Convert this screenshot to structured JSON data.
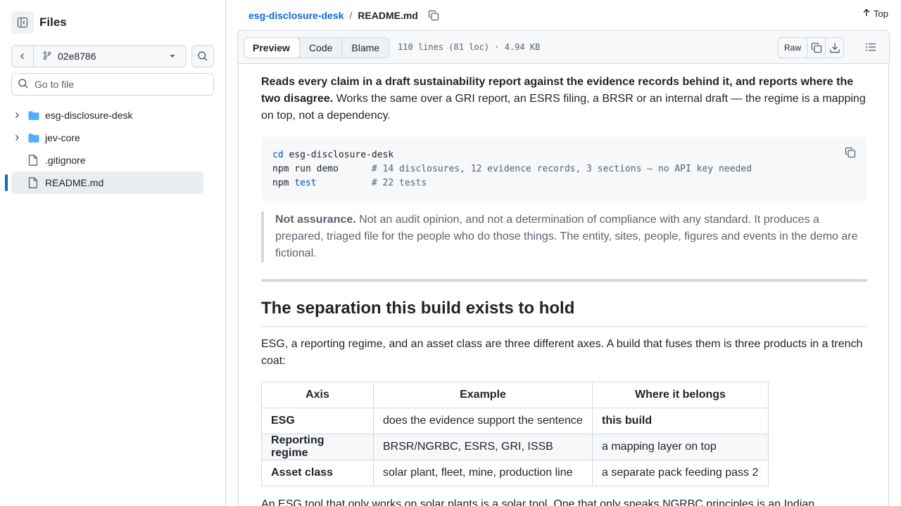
{
  "sidebar": {
    "title": "Files",
    "branch": "02e8786",
    "goto_placeholder": "Go to file",
    "tree": [
      {
        "label": "esg-disclosure-desk",
        "type": "folder"
      },
      {
        "label": "jev-core",
        "type": "folder"
      },
      {
        "label": ".gitignore",
        "type": "file"
      },
      {
        "label": "README.md",
        "type": "file",
        "active": true
      }
    ]
  },
  "breadcrumb": {
    "repo": "esg-disclosure-desk",
    "separator": "/",
    "file": "README.md"
  },
  "top_label": "Top",
  "file_header": {
    "tabs": [
      "Preview",
      "Code",
      "Blame"
    ],
    "active_tab": "Preview",
    "meta": "110 lines (81 loc) · 4.94 KB",
    "raw_label": "Raw"
  },
  "readme": {
    "lead_bold": "Reads every claim in a draft sustainability report against the evidence records behind it, and reports where the two disagree.",
    "lead_rest": " Works the same over a GRI report, an ESRS filing, a BRSR or an internal draft — the regime is a mapping on top, not a dependency.",
    "code": {
      "line1_cmd": "cd",
      "line1_rest": " esg-disclosure-desk",
      "line2_cmd": "npm run demo      ",
      "line2_comment": "# 14 disclosures, 12 evidence records, 3 sections — no API key needed",
      "line3_cmd": "npm ",
      "line3_kw": "test",
      "line3_pad": "          ",
      "line3_comment": "# 22 tests"
    },
    "quote_bold": "Not assurance.",
    "quote_rest": " Not an audit opinion, and not a determination of compliance with any standard. It produces a prepared, triaged file for the people who do those things. The entity, sites, people, figures and events in the demo are fictional.",
    "heading": "The separation this build exists to hold",
    "paragraph": "ESG, a reporting regime, and an asset class are three different axes. A build that fuses them is three products in a trench coat:",
    "table": {
      "headers": [
        "Axis",
        "Example",
        "Where it belongs"
      ],
      "rows": [
        [
          "ESG",
          "does the evidence support the sentence",
          "this build"
        ],
        [
          "Reporting regime",
          "BRSR/NGRBC, ESRS, GRI, ISSB",
          "a mapping layer on top"
        ],
        [
          "Asset class",
          "solar plant, fleet, mine, production line",
          "a separate pack feeding pass 2"
        ]
      ]
    },
    "tail": "An ESG tool that only works on solar plants is a solar tool. One that only speaks NGRBC principles is an Indian"
  },
  "icons": [
    "sidebar-collapse-icon",
    "chevron-left-icon",
    "git-branch-icon",
    "triangle-down-icon",
    "search-icon",
    "chevron-right-icon",
    "folder-icon",
    "file-icon",
    "copy-icon",
    "arrow-up-icon",
    "download-icon",
    "list-icon"
  ],
  "colors": {
    "link": "#0969da",
    "folder": "#54aeff",
    "border": "#d1d9e0",
    "muted": "#59636e",
    "keyword": "#0550ae"
  }
}
